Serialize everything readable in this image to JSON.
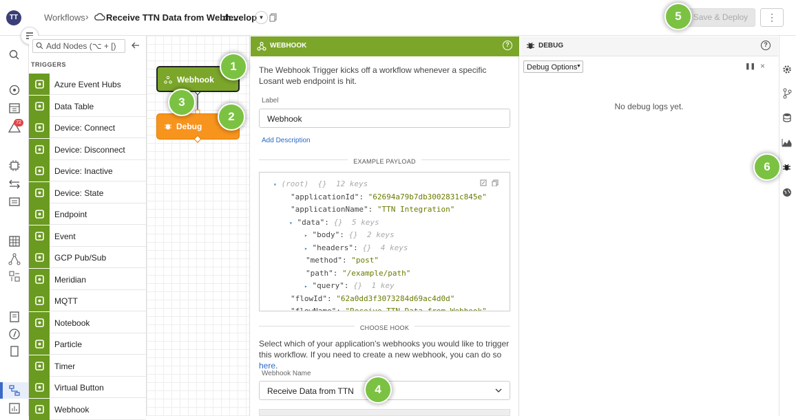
{
  "header": {
    "avatar_initials": "TT",
    "breadcrumb_workflows": "Workflows",
    "breadcrumb_sep": "›",
    "workflow_title": "Receive TTN Data from Webh...",
    "branch": "develop",
    "deploy_label": "Save & Deploy",
    "more_label": "⋮"
  },
  "nav": {
    "alert_count": "72"
  },
  "palette": {
    "search_placeholder": "Add Nodes (⌥ + [)",
    "section_title": "TRIGGERS",
    "items": [
      {
        "label": "Azure Event Hubs",
        "icon": "azure-icon"
      },
      {
        "label": "Data Table",
        "icon": "table-icon"
      },
      {
        "label": "Device: Connect",
        "icon": "device-icon"
      },
      {
        "label": "Device: Disconnect",
        "icon": "device-icon"
      },
      {
        "label": "Device: Inactive",
        "icon": "device-icon"
      },
      {
        "label": "Device: State",
        "icon": "device-icon"
      },
      {
        "label": "Endpoint",
        "icon": "endpoint-icon"
      },
      {
        "label": "Event",
        "icon": "warning-icon"
      },
      {
        "label": "GCP Pub/Sub",
        "icon": "gcp-icon"
      },
      {
        "label": "Meridian",
        "icon": "meridian-icon"
      },
      {
        "label": "MQTT",
        "icon": "mqtt-icon"
      },
      {
        "label": "Notebook",
        "icon": "notebook-icon"
      },
      {
        "label": "Particle",
        "icon": "particle-icon"
      },
      {
        "label": "Timer",
        "icon": "timer-icon"
      },
      {
        "label": "Virtual Button",
        "icon": "button-icon"
      },
      {
        "label": "Webhook",
        "icon": "webhook-icon"
      }
    ]
  },
  "canvas": {
    "node_webhook": "Webhook",
    "node_debug": "Debug"
  },
  "callouts": [
    "1",
    "2",
    "3",
    "4",
    "5",
    "6"
  ],
  "props": {
    "title": "WEBHOOK",
    "description": "The Webhook Trigger kicks off a workflow whenever a specific Losant web endpoint is hit.",
    "label_caption": "Label",
    "label_value": "Webhook",
    "add_description": "Add Description",
    "example_payload_title": "EXAMPLE PAYLOAD",
    "payload_lines": [
      {
        "tri": "▾",
        "text": "(root)",
        "meta": "{}  12 keys"
      },
      {
        "key": "\"applicationId\"",
        "val": "\"62694a79b7db3002831c845e\""
      },
      {
        "key": "\"applicationName\"",
        "val": "\"TTN Integration\""
      },
      {
        "tri": "▾",
        "key": "\"data\"",
        "meta": "{}  5 keys"
      },
      {
        "tri": "▸",
        "key": "\"body\"",
        "meta": "{}  2 keys"
      },
      {
        "tri": "▸",
        "key": "\"headers\"",
        "meta": "{}  4 keys"
      },
      {
        "key": "\"method\"",
        "val": "\"post\""
      },
      {
        "key": "\"path\"",
        "val": "\"/example/path\""
      },
      {
        "tri": "▸",
        "key": "\"query\"",
        "meta": "{}  1 key"
      },
      {
        "key": "\"flowId\"",
        "val": "\"62a0dd3f3073284d69ac4d0d\""
      },
      {
        "key": "\"flowName\"",
        "val": "\"Receive TTN Data from Webhook\""
      }
    ],
    "choose_hook_title": "CHOOSE HOOK",
    "choose_hook_text": "Select which of your application's webhooks you would like to trigger this workflow. If you need to create a new webhook, you can do so",
    "choose_hook_link": "here",
    "webhook_name_caption": "Webhook Name",
    "webhook_name_value": "Receive Data from TTN"
  },
  "debug": {
    "title": "DEBUG",
    "options_label": "Debug Options",
    "empty_text": "No debug logs yet."
  },
  "colors": {
    "trigger_green": "#7ba62a",
    "debug_orange": "#f7941d",
    "callout_green": "#7bc242"
  }
}
